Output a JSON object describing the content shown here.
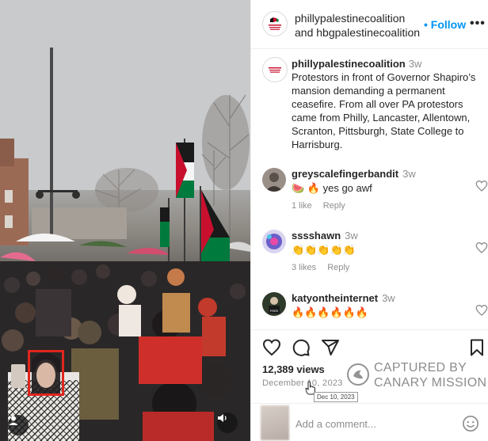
{
  "post": {
    "author_line1": "phillypalestinecoalition",
    "author_line2": "and hbgpalestinecoalition",
    "follow_label": "Follow",
    "more_label": "•••",
    "avatar_text": "THE PHILLY PALESTINE COALITION"
  },
  "caption": {
    "username": "phillypalestinecoalition",
    "time": "3w",
    "text": "Protestors in front of Governor Shapiro’s mansion demanding a permanent ceasefire. From all over PA protestors came from Philly, Lancaster, Allentown, Scranton, Pittsburgh, State College to Harrisburg."
  },
  "comments": [
    {
      "username": "greyscalefingerbandit",
      "time": "3w",
      "text": "🍉 🔥 yes go awf",
      "likes": "1 like",
      "reply": "Reply",
      "icon": "heart-outline-icon"
    },
    {
      "username": "sssshawn",
      "time": "3w",
      "text": "👏👏👏👏👏",
      "likes": "3 likes",
      "reply": "Reply",
      "icon": "heart-outline-icon"
    },
    {
      "username": "katyontheinternet",
      "time": "3w",
      "text": "🔥🔥🔥🔥🔥🔥",
      "icon": "heart-outline-icon"
    }
  ],
  "actions": {
    "views": "12,389 views",
    "date": "December 10, 2023",
    "tooltip": "Dec 10, 2023",
    "icons": [
      "heart-outline-icon",
      "comment-icon",
      "share-icon",
      "bookmark-icon"
    ]
  },
  "add_comment": {
    "placeholder": "Add a comment..."
  },
  "watermark": {
    "line1": "CAPTURED BY",
    "line2": "CANARY MISSION"
  },
  "colors": {
    "follow_blue": "#0095f6",
    "muted_gray": "#8e8e8e",
    "highlight_red": "#e0261d",
    "flag_red": "#c8102e",
    "flag_green": "#007a3d"
  }
}
